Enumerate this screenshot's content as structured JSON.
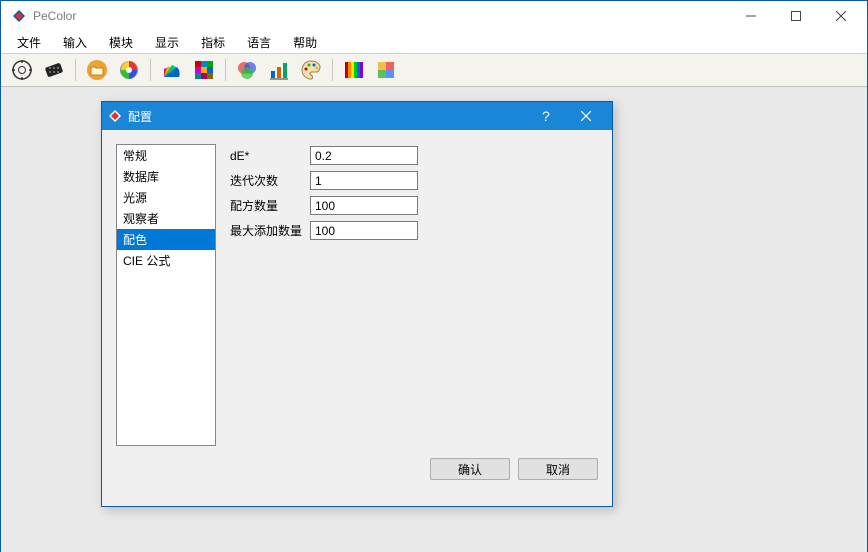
{
  "window": {
    "title": "PeColor"
  },
  "menu": {
    "items": [
      "文件",
      "输入",
      "模块",
      "显示",
      "指标",
      "语言",
      "帮助"
    ]
  },
  "dialog": {
    "title": "配置",
    "categories": [
      "常规",
      "数据库",
      "光源",
      "观察者",
      "配色",
      "CIE 公式"
    ],
    "selected_index": 4,
    "form": {
      "de_label": "dE*",
      "de_value": "0.2",
      "iter_label": "迭代次数",
      "iter_value": "1",
      "recipe_label": "配方数量",
      "recipe_value": "100",
      "maxadd_label": "最大添加数量",
      "maxadd_value": "100"
    },
    "buttons": {
      "ok": "确认",
      "cancel": "取消"
    }
  }
}
